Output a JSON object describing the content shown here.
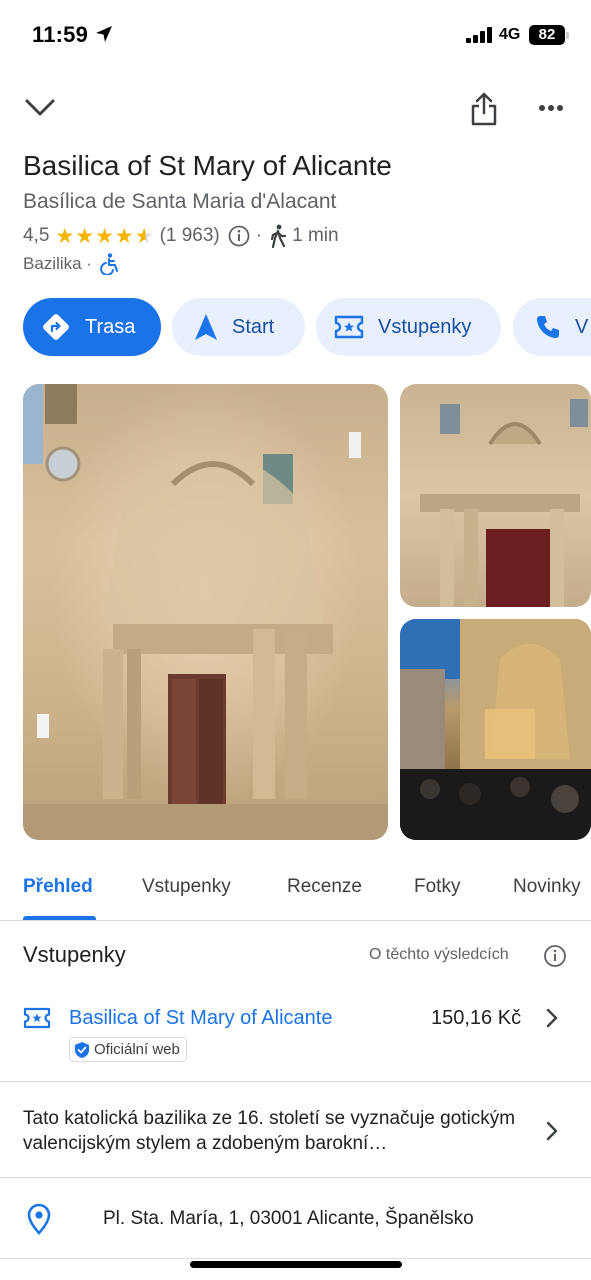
{
  "status_bar": {
    "time": "11:59",
    "network": "4G",
    "battery": "82",
    "icons": [
      "location-arrow-icon",
      "signal-bars-icon",
      "battery-icon"
    ]
  },
  "header": {
    "icons": [
      "chevron-down-icon",
      "share-icon",
      "more-vertical-icon"
    ]
  },
  "place": {
    "title": "Basilica of St Mary of Alicante",
    "local_name": "Basílica de Santa Maria d'Alacant",
    "rating": "4,5",
    "rating_value": 4.5,
    "review_count": "(1 963)",
    "separator": "·",
    "walk_time": "1 min",
    "category": "Bazilika ·",
    "accessibility_icon": "wheelchair-icon"
  },
  "actions": [
    {
      "label": "Trasa",
      "icon": "directions-icon",
      "primary": true
    },
    {
      "label": "Start",
      "icon": "navigation-arrow-icon",
      "primary": false
    },
    {
      "label": "Vstupenky",
      "icon": "ticket-icon",
      "primary": false
    },
    {
      "label": "V",
      "icon": "phone-icon",
      "primary": false
    }
  ],
  "tabs": [
    {
      "label": "Přehled",
      "active": true
    },
    {
      "label": "Vstupenky",
      "active": false
    },
    {
      "label": "Recenze",
      "active": false
    },
    {
      "label": "Fotky",
      "active": false
    },
    {
      "label": "Novinky",
      "active": false
    }
  ],
  "tickets": {
    "title": "Vstupenky",
    "about": "O těchto výsledcích",
    "item": {
      "name": "Basilica of St Mary of Alicante",
      "price": "150,16 Kč",
      "badge": "Oficiální web"
    }
  },
  "description": "Tato katolická bazilika ze 16. století se vyznačuje gotickým valencijským stylem a zdobeným barokní…",
  "address": "Pl. Sta. María, 1, 03001 Alicante, Španělsko",
  "colors": {
    "accent": "#1a73e8",
    "chip_bg": "#e8f0fe",
    "star": "#f4b400",
    "text": "#202124",
    "secondary_text": "#5f6368"
  }
}
